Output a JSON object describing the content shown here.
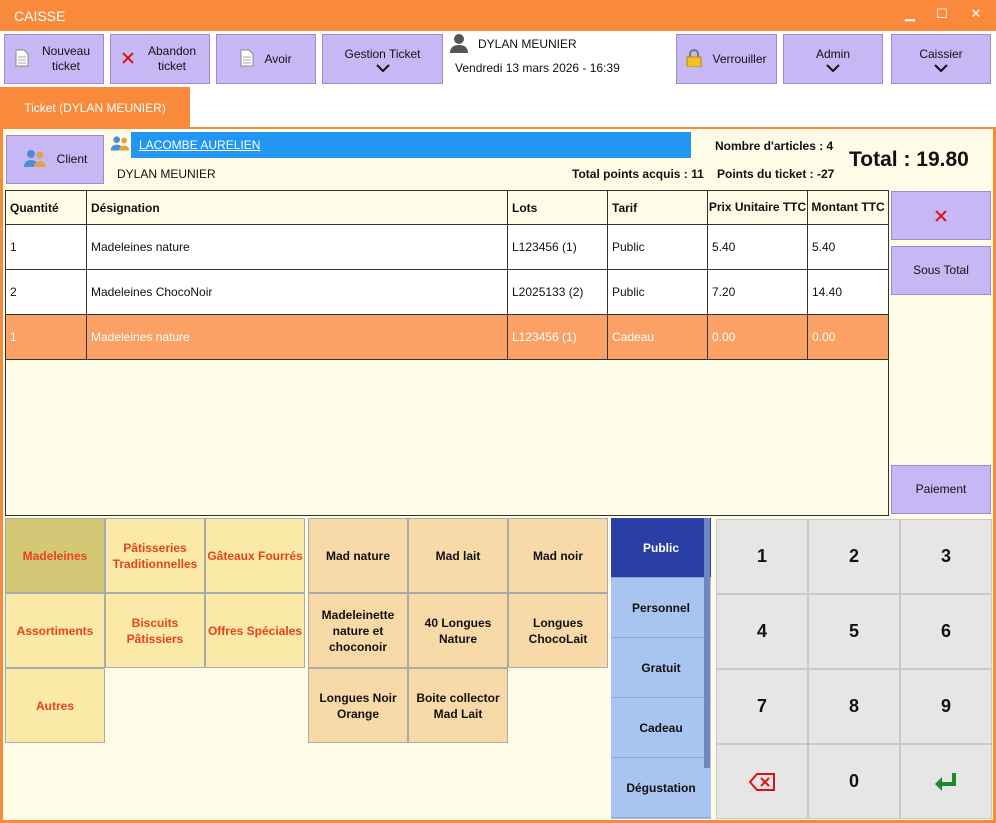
{
  "window": {
    "title": "CAISSE",
    "minimize": "▁",
    "maximize": "☐",
    "close": "✕"
  },
  "toolbar": {
    "nouveau_ticket": "Nouveau ticket",
    "abandon_ticket": "Abandon ticket",
    "avoir": "Avoir",
    "gestion_ticket": "Gestion Ticket",
    "verrouiller": "Verrouiller",
    "admin": "Admin",
    "caissier": "Caissier"
  },
  "user": {
    "name": "DYLAN MEUNIER",
    "datetime": "Vendredi 13 mars 2026 - 16:39"
  },
  "tab": {
    "label": "Ticket (DYLAN MEUNIER)"
  },
  "client": {
    "button_label": "Client",
    "name": "LACOMBE AURELIEN",
    "seller": "DYLAN MEUNIER",
    "nb_articles": "Nombre d'articles : 4",
    "total_points": "Total points acquis : 11",
    "points_ticket": "Points du ticket : -27",
    "total": "Total : 19.80"
  },
  "table": {
    "headers": [
      "Quantité",
      "Désignation",
      "Lots",
      "Tarif",
      "Prix Unitaire TTC",
      "Montant TTC"
    ],
    "rows": [
      [
        "1",
        "Madeleines nature",
        "L123456 (1)",
        "Public",
        "5.40",
        "5.40"
      ],
      [
        "2",
        "Madeleines ChocoNoir",
        "L2025133 (2)",
        "Public",
        "7.20",
        "14.40"
      ],
      [
        "1",
        "Madeleines nature",
        "L123456 (1)",
        "Cadeau",
        "0.00",
        "0.00"
      ]
    ]
  },
  "side_buttons": {
    "sous_total": "Sous Total",
    "paiement": "Paiement"
  },
  "categories": [
    "Madeleines",
    "Pâtisseries Traditionnelles",
    "Gâteaux Fourrés",
    "Assortiments",
    "Biscuits Pâtissiers",
    "Offres Spéciales",
    "Autres"
  ],
  "products": [
    "Mad nature",
    "Mad lait",
    "Mad noir",
    "Madeleinette nature et choconoir",
    "40 Longues Nature",
    "Longues ChocoLait",
    "Longues Noir Orange",
    "Boite collector Mad Lait"
  ],
  "tarifs": [
    "Public",
    "Personnel",
    "Gratuit",
    "Cadeau",
    "Dégustation"
  ],
  "keypad": [
    "1",
    "2",
    "3",
    "4",
    "5",
    "6",
    "7",
    "8",
    "9",
    "0"
  ],
  "colors": {
    "accent": "#f98a3b",
    "button": "#c8b7f5",
    "selected_row": "#fba165",
    "tarif_selected": "#2a3fa5",
    "tarif": "#a8c4f0",
    "client_bar": "#2196f3"
  }
}
